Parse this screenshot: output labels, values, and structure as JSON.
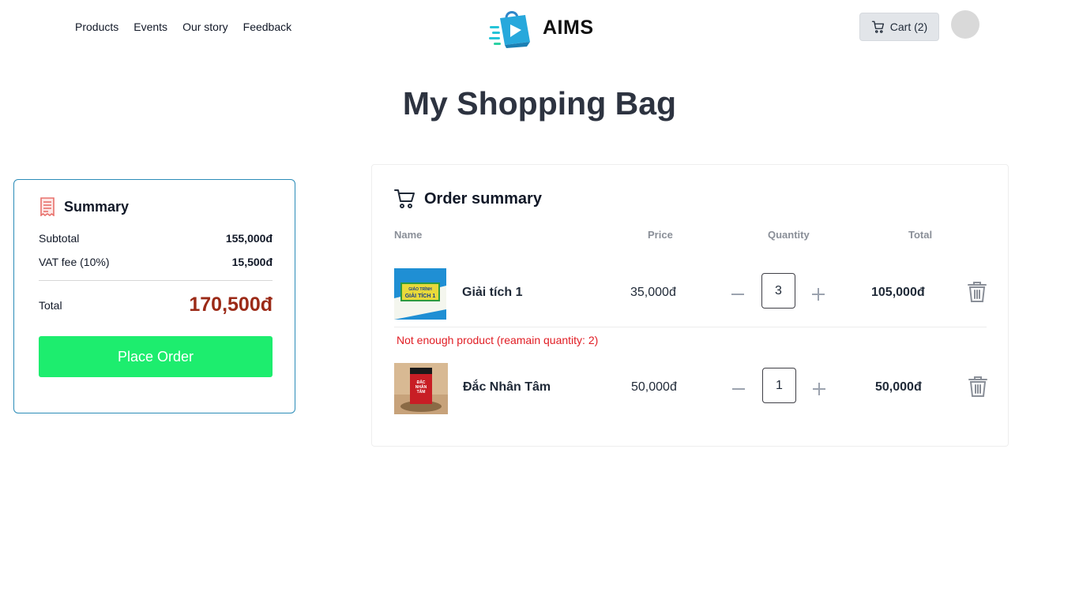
{
  "nav": {
    "items": [
      "Products",
      "Events",
      "Our story",
      "Feedback"
    ]
  },
  "brand": {
    "name": "AIMS"
  },
  "cart": {
    "label": "Cart (2)"
  },
  "page": {
    "title": "My Shopping Bag"
  },
  "summary": {
    "title": "Summary",
    "subtotal_label": "Subtotal",
    "subtotal_value": "155,000đ",
    "vat_label": "VAT fee (10%)",
    "vat_value": "15,500đ",
    "total_label": "Total",
    "total_value": "170,500đ",
    "place_order_label": "Place Order"
  },
  "order": {
    "title": "Order summary",
    "columns": {
      "name": "Name",
      "price": "Price",
      "quantity": "Quantity",
      "total": "Total"
    },
    "items": [
      {
        "name": "Giải tích 1",
        "price": "35,000đ",
        "quantity": "3",
        "total": "105,000đ",
        "cover_text": [
          "GIÁO TRÌNH",
          "GIẢI TÍCH 1"
        ]
      },
      {
        "name": "Đắc Nhân Tâm",
        "price": "50,000đ",
        "quantity": "1",
        "total": "50,000đ",
        "cover_text": [
          "ĐẮC",
          "NHÂN",
          "TÂM"
        ]
      }
    ],
    "error_message": "Not enough product (reamain quantity: 2)"
  },
  "colors": {
    "accent_green": "#1ded6e",
    "total_red": "#9b2a17",
    "error_red": "#e11d24",
    "summary_border": "#2b8cb8"
  },
  "icons": [
    "logo-icon",
    "cart-icon",
    "receipt-icon",
    "shopping-cart-icon",
    "minus-icon",
    "plus-icon",
    "trash-icon"
  ]
}
